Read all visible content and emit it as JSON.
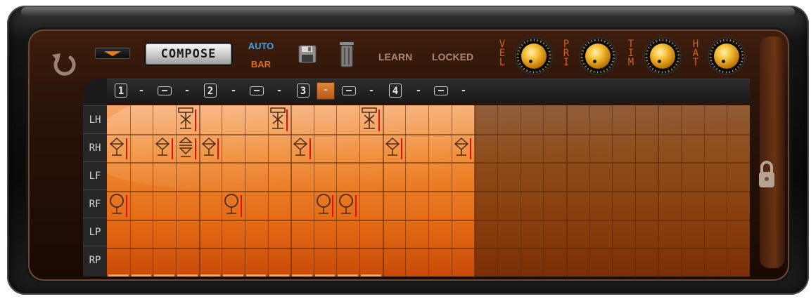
{
  "toolbar": {
    "compose_label": "COMPOSE",
    "auto_label": "AUTO",
    "bar_label": "BAR",
    "learn_label": "LEARN",
    "locked_label": "LOCKED",
    "icons": [
      "undo-icon",
      "dropdown-arrow-icon",
      "save-icon",
      "trash-icon",
      "lock-icon"
    ]
  },
  "knobs": [
    {
      "name": "VEL",
      "letters": [
        "V",
        "E",
        "L"
      ]
    },
    {
      "name": "PRI",
      "letters": [
        "P",
        "R",
        "I"
      ]
    },
    {
      "name": "TIM",
      "letters": [
        "T",
        "I",
        "M"
      ]
    },
    {
      "name": "HAT",
      "letters": [
        "H",
        "A",
        "T"
      ]
    }
  ],
  "header": {
    "beats": [
      "1",
      "2",
      "3",
      "4"
    ],
    "dash": "-",
    "highlight_label": "-"
  },
  "rows": {
    "labels": [
      "LH",
      "RH",
      "LF",
      "RF",
      "LP",
      "RP"
    ]
  },
  "colors": {
    "accent": "#f08a33",
    "auto": "#35a6ea",
    "bar": "#e66b14",
    "marker": "#e01010"
  }
}
